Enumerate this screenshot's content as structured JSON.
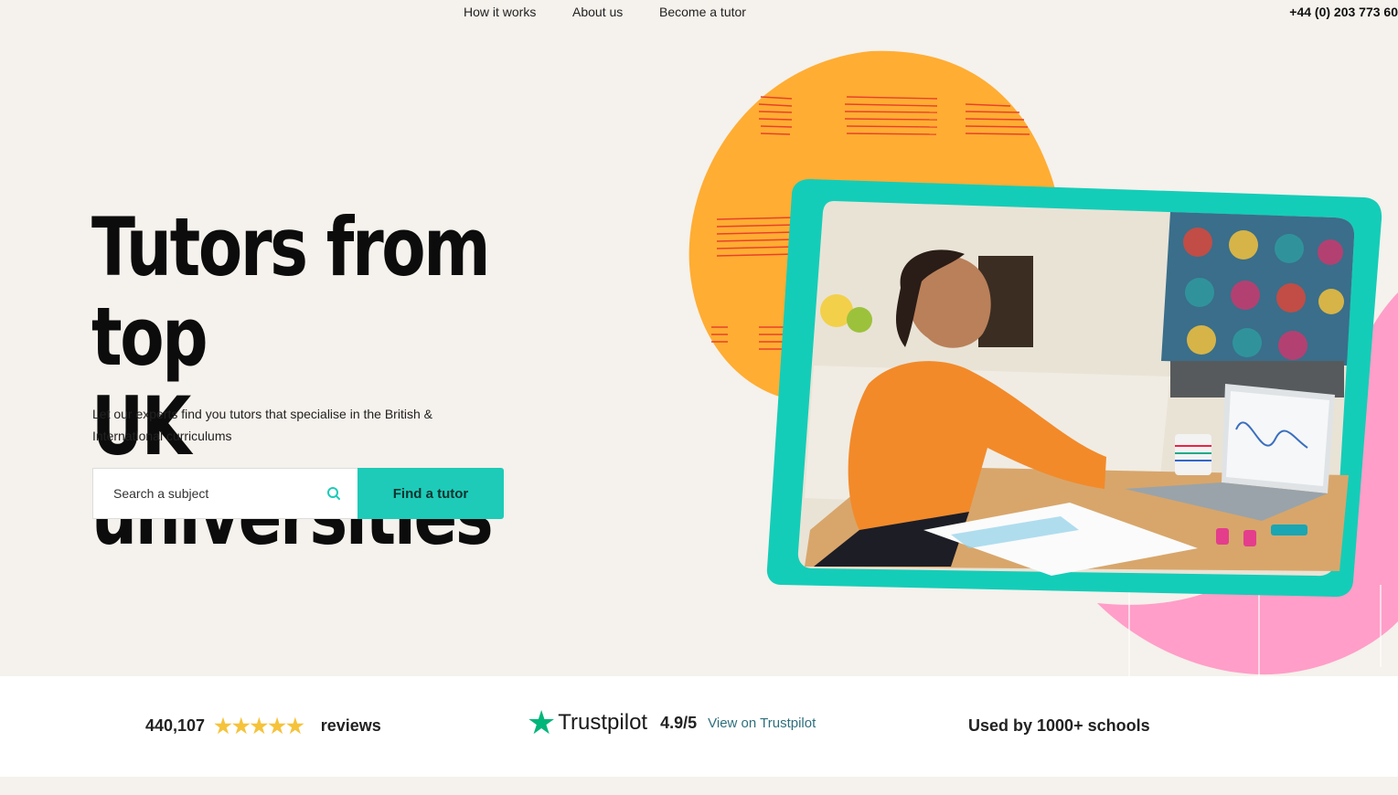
{
  "nav": {
    "links": [
      "How it works",
      "About us",
      "Become a tutor"
    ],
    "phone": "+44 (0) 203 773 60"
  },
  "hero": {
    "title_line1": "Tutors from top",
    "title_line2": "UK universities",
    "subtitle_line1": "Let our experts find you tutors that specialise in the British &",
    "subtitle_line2": "International curriculums",
    "search_placeholder": "Search a subject",
    "cta_label": "Find a tutor"
  },
  "stats": {
    "reviews_count": "440,107",
    "stars_rating": 5,
    "reviews_label": "reviews",
    "trustpilot_brand": "Trustpilot",
    "trustpilot_score": "4.9/5",
    "trustpilot_link": "View on Trustpilot",
    "schools_label": "Used by 1000+ schools"
  },
  "colors": {
    "accent": "#1dcbb8",
    "orange_blob": "#ffad33",
    "pink_blob": "#ff9ec8",
    "frame": "#14cdb8",
    "star": "#f5c33b",
    "trustpilot_green": "#00b67a"
  },
  "icons": {
    "search": "search-icon",
    "star": "star-icon",
    "trustpilot": "trustpilot-star-icon"
  }
}
